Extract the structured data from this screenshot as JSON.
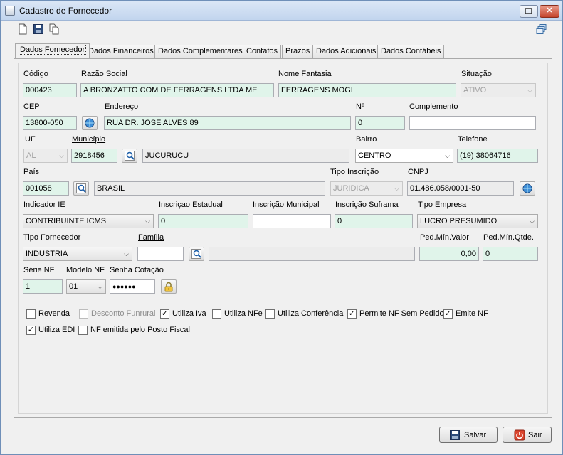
{
  "window": {
    "title": "Cadastro de Fornecedor"
  },
  "toolbar": {
    "icons": [
      "new-document-icon",
      "save-icon",
      "copy-icon",
      "windows-icon"
    ]
  },
  "tabs": [
    {
      "label": "Dados Fornecedor",
      "active": true
    },
    {
      "label": "Dados Financeiros"
    },
    {
      "label": "Dados Complementares"
    },
    {
      "label": "Contatos"
    },
    {
      "label": "Prazos"
    },
    {
      "label": "Dados Adicionais"
    },
    {
      "label": "Dados Contábeis"
    }
  ],
  "form": {
    "codigo": {
      "label": "Código",
      "value": "000423"
    },
    "razao_social": {
      "label": "Razão Social",
      "value": "A BRONZATTO COM DE FERRAGENS LTDA ME"
    },
    "nome_fantasia": {
      "label": "Nome Fantasia",
      "value": "FERRAGENS MOGI"
    },
    "situacao": {
      "label": "Situação",
      "value": "ATIVO"
    },
    "cep": {
      "label": "CEP",
      "value": "13800-050"
    },
    "endereco": {
      "label": "Endereço",
      "value": "RUA DR. JOSE ALVES 89"
    },
    "numero": {
      "label": "Nº",
      "value": "0"
    },
    "complemento": {
      "label": "Complemento",
      "value": ""
    },
    "uf": {
      "label": "UF",
      "value": "AL"
    },
    "municipio": {
      "label": "Município",
      "code": "2918456",
      "name": "JUCURUCU"
    },
    "bairro": {
      "label": "Bairro",
      "value": "CENTRO"
    },
    "telefone": {
      "label": "Telefone",
      "value": "(19) 38064716"
    },
    "pais": {
      "label": "País",
      "code": "001058",
      "name": "BRASIL"
    },
    "tipo_inscricao": {
      "label": "Tipo Inscrição",
      "value": "JURIDICA"
    },
    "cnpj": {
      "label": "CNPJ",
      "value": "01.486.058/0001-50"
    },
    "indicador_ie": {
      "label": "Indicador IE",
      "value": "CONTRIBUINTE ICMS"
    },
    "inscricao_estadual": {
      "label": "Inscriçao Estadual",
      "value": "0"
    },
    "inscricao_municipal": {
      "label": "Inscrição Municipal",
      "value": ""
    },
    "inscricao_suframa": {
      "label": "Inscrição Suframa",
      "value": "0"
    },
    "tipo_empresa": {
      "label": "Tipo Empresa",
      "value": "LUCRO PRESUMIDO"
    },
    "tipo_fornecedor": {
      "label": "Tipo Fornecedor",
      "value": "INDUSTRIA"
    },
    "familia": {
      "label": "Família",
      "code": "",
      "name": ""
    },
    "ped_min_valor": {
      "label": "Ped.Mín.Valor",
      "value": "0,00"
    },
    "ped_min_qtde": {
      "label": "Ped.Mín.Qtde.",
      "value": "0"
    },
    "serie_nf": {
      "label": "Série NF",
      "value": "1"
    },
    "modelo_nf": {
      "label": "Modelo NF",
      "value": "01"
    },
    "senha_cotacao": {
      "label": "Senha Cotação",
      "value": "●●●●●●"
    }
  },
  "checks": [
    {
      "label": "Revenda",
      "checked": false
    },
    {
      "label": "Desconto Funrural",
      "checked": false,
      "disabled": true
    },
    {
      "label": "Utiliza Iva",
      "checked": true
    },
    {
      "label": "Utiliza NFe",
      "checked": false
    },
    {
      "label": "Utiliza Conferência",
      "checked": false
    },
    {
      "label": "Permite NF Sem Pedido",
      "checked": true
    },
    {
      "label": "Emite NF",
      "checked": true
    },
    {
      "label": "Utiliza EDI",
      "checked": true
    },
    {
      "label": "NF emitida pelo Posto Fiscal",
      "checked": false
    }
  ],
  "actions": {
    "save_label": "Salvar",
    "exit_label": "Sair"
  },
  "glyphs": {
    "check": "✓",
    "arrow": "⌵",
    "close": "✕"
  },
  "colors": {
    "field_green": "#e0f4ea",
    "title_bar": "#c2d5ee"
  }
}
